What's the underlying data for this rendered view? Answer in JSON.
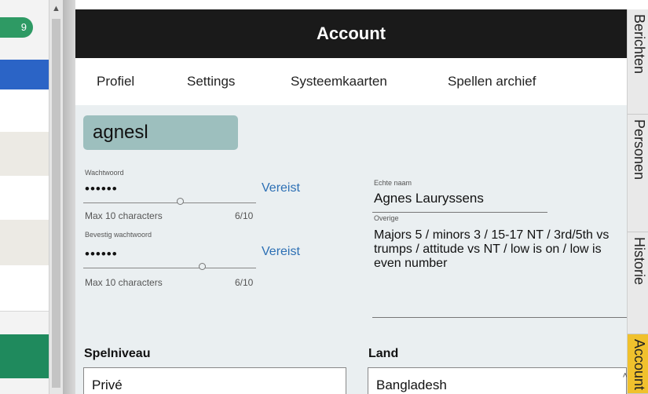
{
  "left_panel": {
    "badge": "9"
  },
  "dialog": {
    "title": "Account",
    "tabs": [
      "Profiel",
      "Settings",
      "Systeemkaarten",
      "Spellen archief"
    ]
  },
  "profile": {
    "username": "agnesl",
    "password": {
      "label": "Wachtwoord",
      "dots": "••••••",
      "status": "Vereist",
      "hint": "Max 10 characters",
      "count": "6/10"
    },
    "confirm_password": {
      "label": "Bevestig wachtwoord",
      "dots": "••••••",
      "status": "Vereist",
      "hint": "Max 10 characters",
      "count": "6/10"
    },
    "real_name": {
      "label": "Echte naam",
      "value": "Agnes Lauryssens"
    },
    "other": {
      "label": "Overige",
      "value": "Majors 5 / minors 3 / 15-17 NT / 3rd/5th vs trumps / attitude vs NT / low is on / low is even number"
    },
    "play_level": {
      "label": "Spelniveau",
      "value": "Privé"
    },
    "country": {
      "label": "Land",
      "value": "Bangladesh"
    }
  },
  "side_tabs": [
    "Berichten",
    "Personen",
    "Historie",
    "Account"
  ],
  "colors": {
    "title_bar": "#1a1a1a",
    "active_side_tab": "#f0c12d",
    "link": "#2c6fb4",
    "username_bg": "#9dbfbe"
  }
}
